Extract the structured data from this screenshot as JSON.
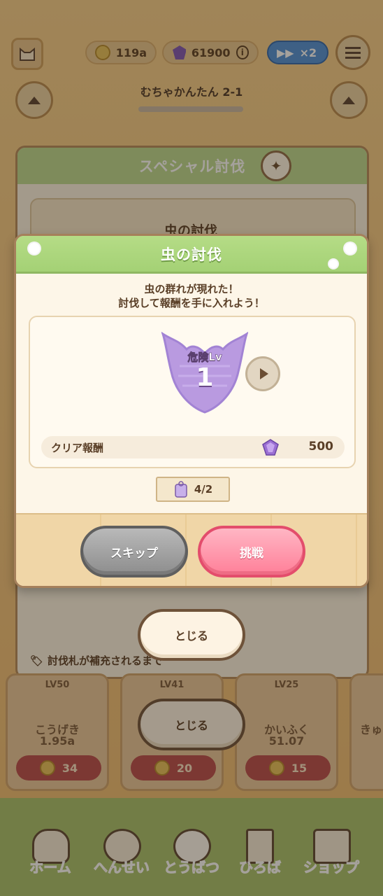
{
  "top_bar": {
    "coins": "119a",
    "gems": "61900",
    "speed_label": "×2",
    "stage_name": "むちゃかんたん 2-1"
  },
  "back_panel": {
    "title": "スペシャル討伐",
    "card_title": "虫の討伐",
    "note": "討伐札が補充されるまで",
    "close_label": "とじる"
  },
  "upgrades": [
    {
      "level": "LV50",
      "name": "こうげき",
      "value": "1.95a",
      "cost": "34"
    },
    {
      "level": "LV41",
      "name": "",
      "value": "",
      "cost": "20"
    },
    {
      "level": "LV25",
      "name": "かいふく",
      "value": "51.07",
      "cost": "15"
    },
    {
      "level": "",
      "name": "きゅ",
      "value": "",
      "cost": ""
    }
  ],
  "bottom_nav": {
    "items": [
      "ホーム",
      "へんせい",
      "とうばつ",
      "ひろば",
      "ショップ"
    ]
  },
  "dialog": {
    "title": "虫の討伐",
    "message_line1": "虫の群れが現れた！",
    "message_line2": "討伐して報酬を手に入れよう！",
    "danger_label": "危険Lv",
    "danger_level": "1",
    "reward_label": "クリア報酬",
    "reward_value": "500",
    "ticket_count": "4/2",
    "skip_label": "スキップ",
    "challenge_label": "挑戦",
    "close_label": "とじる"
  },
  "colors": {
    "header_green": "#a4d175",
    "challenge_pink": "#ff7f98",
    "danger_purple": "#b99ae0"
  }
}
